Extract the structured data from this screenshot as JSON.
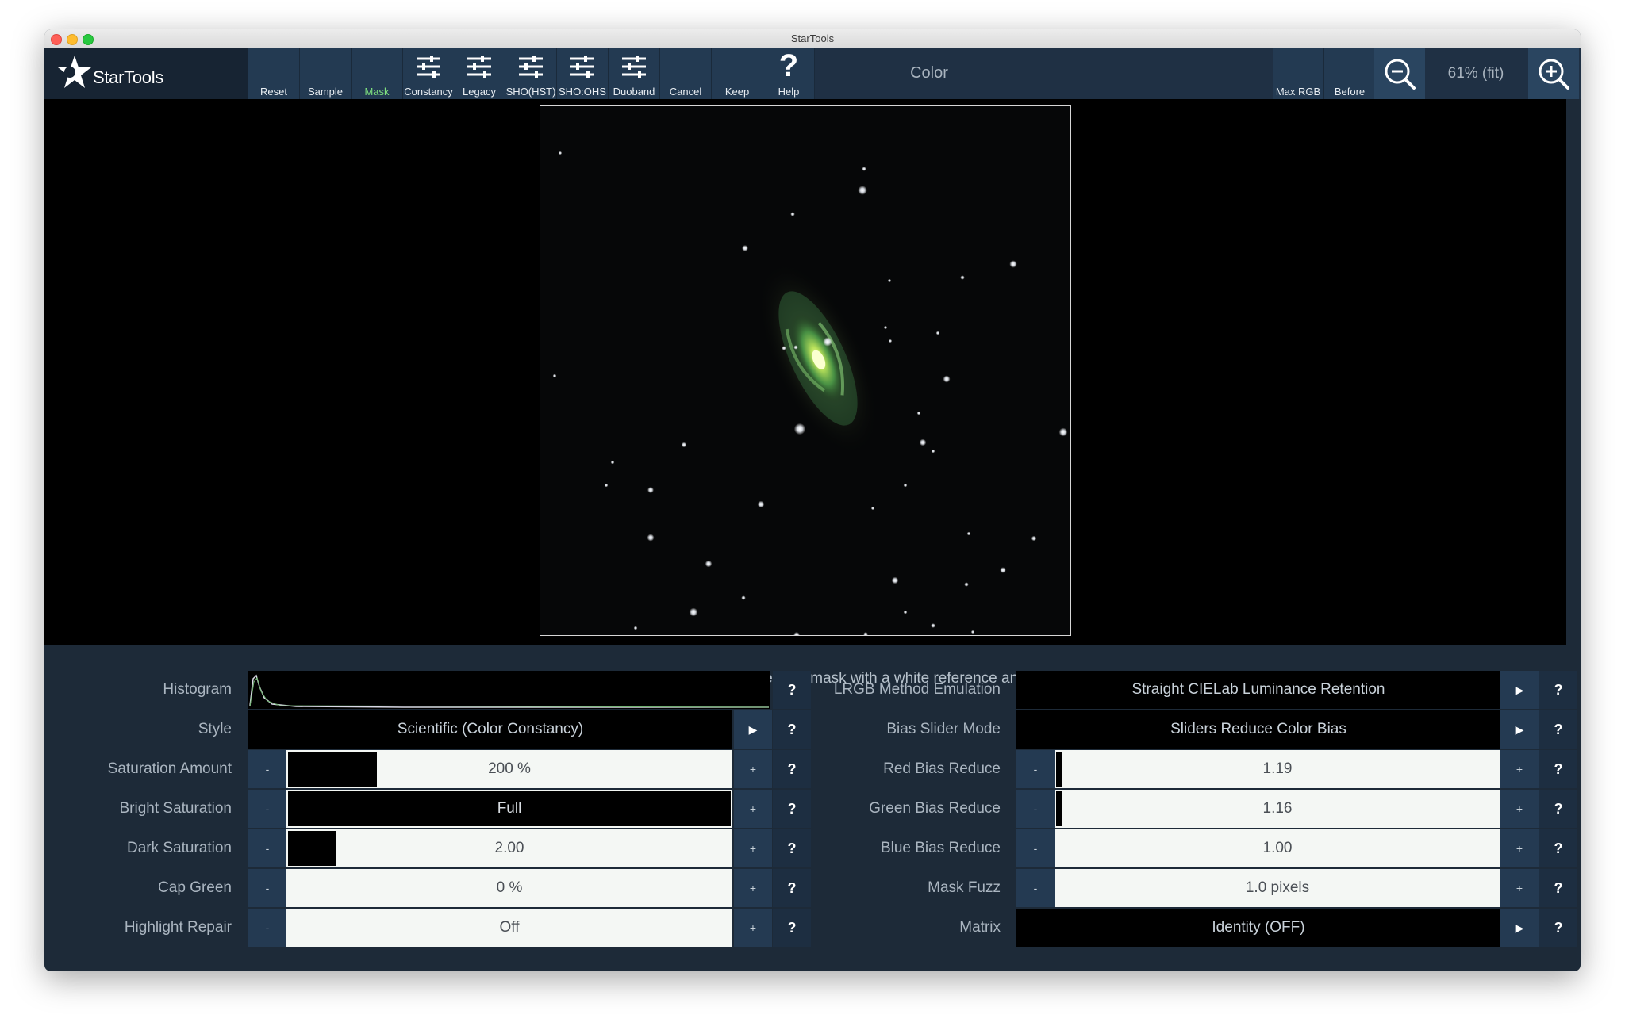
{
  "window": {
    "title": "StarTools"
  },
  "app": {
    "name": "StarTools"
  },
  "toolbar": {
    "buttons": [
      {
        "label": "Reset",
        "icon": "none",
        "active": false
      },
      {
        "label": "Sample",
        "icon": "none",
        "active": false
      },
      {
        "label": "Mask",
        "icon": "none",
        "active": true
      },
      {
        "label": "Constancy",
        "icon": "sliders-icon",
        "active": false
      },
      {
        "label": "Legacy",
        "icon": "sliders-icon",
        "active": false
      },
      {
        "label": "SHO(HST)",
        "icon": "sliders-icon",
        "active": false
      },
      {
        "label": "SHO:OHS",
        "icon": "sliders-icon",
        "active": false
      },
      {
        "label": "Duoband",
        "icon": "sliders-icon",
        "active": false
      },
      {
        "label": "Cancel",
        "icon": "none",
        "active": false
      },
      {
        "label": "Keep",
        "icon": "none",
        "active": false
      },
      {
        "label": "Help",
        "icon": "question-icon",
        "active": false
      }
    ],
    "module_title": "Color",
    "max_rgb_label": "Max RGB",
    "before_label": "Before",
    "zoom_level": "61% (fit)",
    "active_color": "#7fe27f"
  },
  "instruction": "Optionally, click on a white area in the image, or create a mask with a white reference and click 'Sample' (see help).",
  "left_params": [
    {
      "label": "Histogram",
      "kind": "histogram"
    },
    {
      "label": "Style",
      "kind": "select",
      "value": "Scientific (Color Constancy)"
    },
    {
      "label": "Saturation Amount",
      "kind": "slider",
      "value": "200 %",
      "fraction": 0.2
    },
    {
      "label": "Bright Saturation",
      "kind": "slider",
      "value": "Full",
      "fraction": 1.0
    },
    {
      "label": "Dark Saturation",
      "kind": "slider",
      "value": "2.00",
      "fraction": 0.11
    },
    {
      "label": "Cap Green",
      "kind": "slider",
      "value": "0 %",
      "fraction": 0.0
    },
    {
      "label": "Highlight Repair",
      "kind": "slider",
      "value": "Off",
      "fraction": 0.0
    }
  ],
  "right_params": [
    {
      "label": "LRGB Method Emulation",
      "kind": "select",
      "value": "Straight CIELab Luminance Retention"
    },
    {
      "label": "Bias Slider Mode",
      "kind": "select",
      "value": "Sliders Reduce Color Bias"
    },
    {
      "label": "Red Bias Reduce",
      "kind": "slider",
      "value": "1.19",
      "fraction": 0.015
    },
    {
      "label": "Green Bias Reduce",
      "kind": "slider",
      "value": "1.16",
      "fraction": 0.013
    },
    {
      "label": "Blue Bias Reduce",
      "kind": "slider",
      "value": "1.00",
      "fraction": 0.0
    },
    {
      "label": "Mask Fuzz",
      "kind": "slider",
      "value": "1.0 pixels",
      "fraction": 0.0
    },
    {
      "label": "Matrix",
      "kind": "select",
      "value": "Identity (OFF)"
    }
  ],
  "controls": {
    "minus": "-",
    "plus": "+",
    "help": "?",
    "arrow": "▶"
  }
}
